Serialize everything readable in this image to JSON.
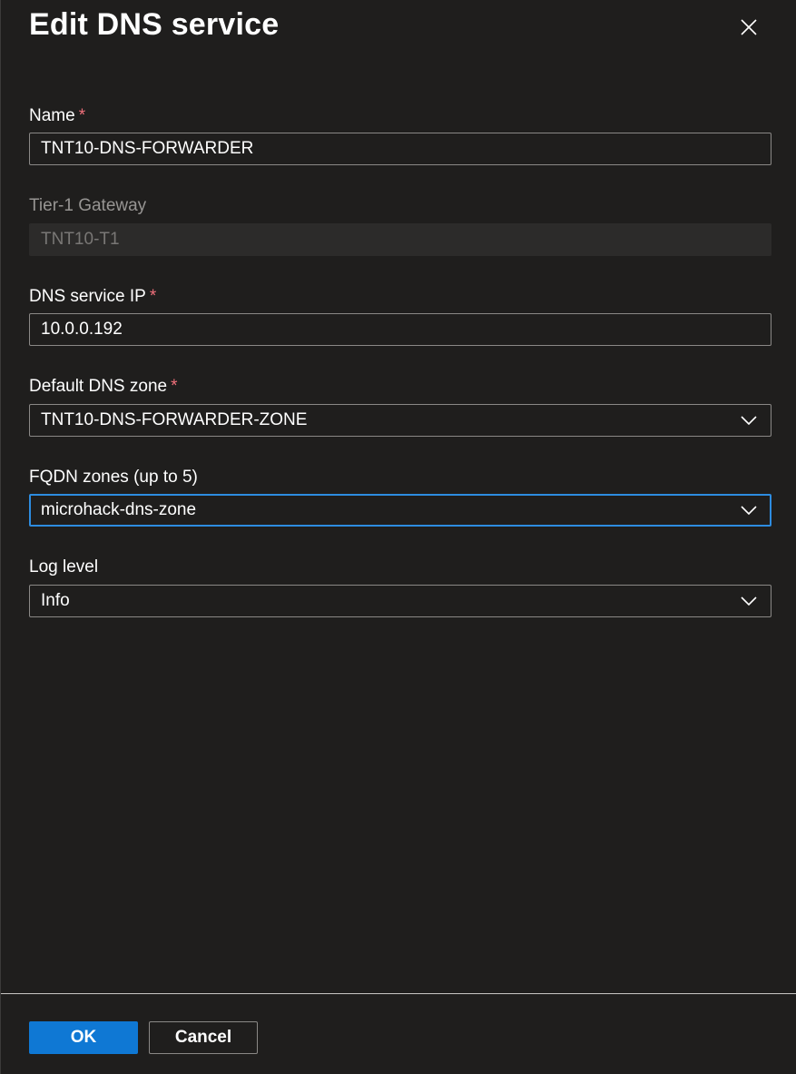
{
  "dialog": {
    "title": "Edit DNS service"
  },
  "fields": {
    "name": {
      "label": "Name",
      "required_mark": "*",
      "value": "TNT10-DNS-FORWARDER"
    },
    "tier1_gateway": {
      "label": "Tier-1 Gateway",
      "value": "TNT10-T1"
    },
    "dns_service_ip": {
      "label": "DNS service IP",
      "required_mark": "*",
      "value": "10.0.0.192"
    },
    "default_dns_zone": {
      "label": "Default DNS zone",
      "required_mark": "*",
      "value": "TNT10-DNS-FORWARDER-ZONE"
    },
    "fqdn_zones": {
      "label": "FQDN zones (up to 5)",
      "value": "microhack-dns-zone"
    },
    "log_level": {
      "label": "Log level",
      "value": "Info"
    }
  },
  "footer": {
    "ok_label": "OK",
    "cancel_label": "Cancel"
  },
  "icons": {
    "close": "close-icon",
    "dropdown": "chevron-down-icon"
  },
  "colors": {
    "background": "#1f1e1d",
    "primary": "#0f78d4",
    "focus_border": "#2d8ce0",
    "required": "#f1707b"
  }
}
